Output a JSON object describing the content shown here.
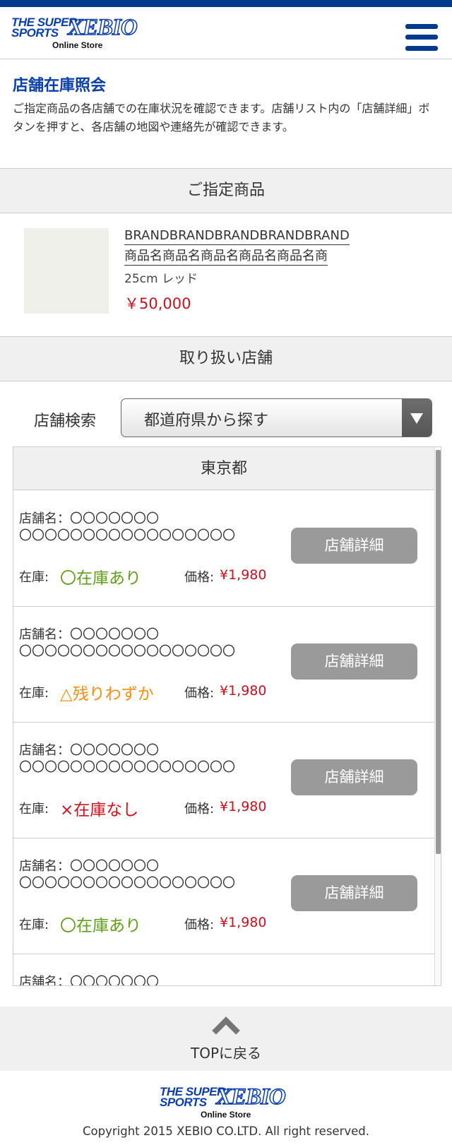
{
  "header": {
    "logo": {
      "super": "THE SUPER SPORTS",
      "brand": "XEBIO",
      "sub": "Online Store"
    },
    "menu_icon": "hamburger-menu-icon"
  },
  "intro": {
    "title": "店舗在庫照会",
    "text": "ご指定商品の各店舗での在庫状況を確認できます。店舗リスト内の「店舗詳細」ボタンを押すと、各店舗の地図や連絡先が確認できます。"
  },
  "product_section": {
    "heading": "ご指定商品",
    "brand": "BRANDBRANDBRANDBRANDBRAND",
    "name": "商品名商品名商品名商品名商品名商",
    "variant": "25cm レッド",
    "price": "￥50,000"
  },
  "stores_section": {
    "heading": "取り扱い店舗",
    "search_label": "店舗検索",
    "select_value": "都道府県から探す",
    "prefecture": "東京都",
    "stores": [
      {
        "name": "店舗名：〇〇〇〇〇〇〇\n〇〇〇〇〇〇〇〇〇〇〇〇〇〇〇〇〇",
        "stock_label": "在庫:",
        "stock": "〇在庫あり",
        "stock_status": "in",
        "price_label": "価格:",
        "price": "¥1,980",
        "button": "店舗詳細"
      },
      {
        "name": "店舗名：〇〇〇〇〇〇〇\n〇〇〇〇〇〇〇〇〇〇〇〇〇〇〇〇〇",
        "stock_label": "在庫:",
        "stock": "△残りわずか",
        "stock_status": "low",
        "price_label": "価格:",
        "price": "¥1,980",
        "button": "店舗詳細"
      },
      {
        "name": "店舗名：〇〇〇〇〇〇〇\n〇〇〇〇〇〇〇〇〇〇〇〇〇〇〇〇〇",
        "stock_label": "在庫:",
        "stock": "×在庫なし",
        "stock_status": "out",
        "price_label": "価格:",
        "price": "¥1,980",
        "button": "店舗詳細"
      },
      {
        "name": "店舗名：〇〇〇〇〇〇〇\n〇〇〇〇〇〇〇〇〇〇〇〇〇〇〇〇〇",
        "stock_label": "在庫:",
        "stock": "〇在庫あり",
        "stock_status": "in",
        "price_label": "価格:",
        "price": "¥1,980",
        "button": "店舗詳細"
      },
      {
        "name": "店舗名：〇〇〇〇〇〇〇",
        "stock_label": "",
        "stock": "",
        "stock_status": "",
        "price_label": "",
        "price": "",
        "button": ""
      }
    ]
  },
  "footer": {
    "back_to_top": "TOPに戻る",
    "copyright": "Copyright 2015 XEBIO CO.LTD. All right reserved.",
    "colors": {
      "brand_blue": "#0a3ea8",
      "price_red": "#c8111e",
      "in_stock": "#5f9f1b",
      "low_stock": "#f28f13",
      "out_of_stock": "#d0121d"
    }
  }
}
